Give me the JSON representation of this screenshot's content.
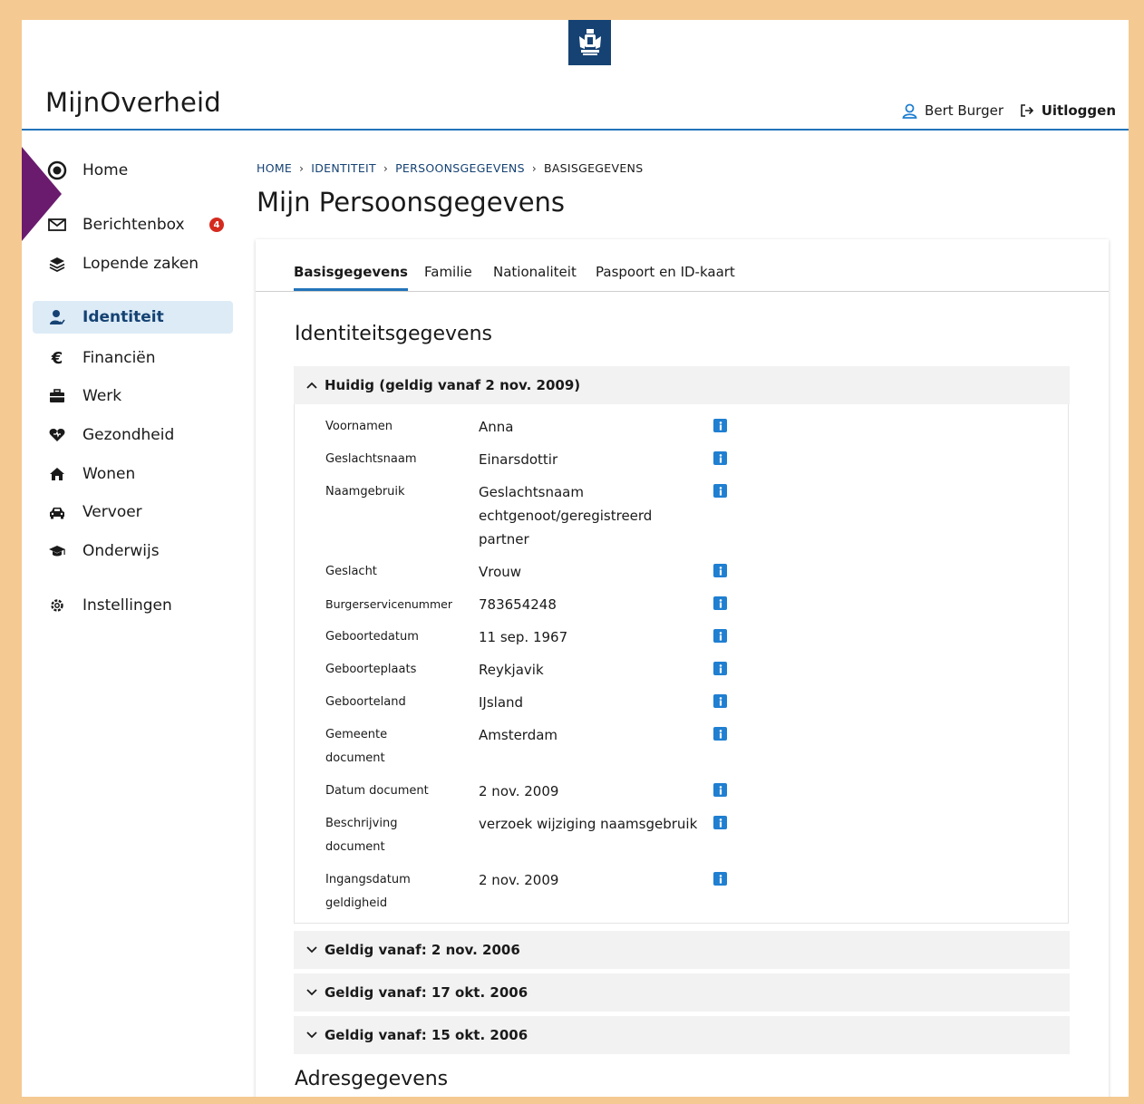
{
  "app": {
    "brand": "MijnOverheid"
  },
  "header": {
    "user_name": "Bert Burger",
    "logout_label": "Uitloggen"
  },
  "sidebar": {
    "items": [
      {
        "label": "Home",
        "icon": "home-circle-icon"
      },
      {
        "label": "Berichtenbox",
        "icon": "envelope-icon",
        "badge": "4"
      },
      {
        "label": "Lopende zaken",
        "icon": "layers-icon"
      },
      {
        "label": "Identiteit",
        "icon": "person-icon",
        "active": true
      },
      {
        "label": "Financiën",
        "icon": "euro-icon"
      },
      {
        "label": "Werk",
        "icon": "briefcase-icon"
      },
      {
        "label": "Gezondheid",
        "icon": "heart-icon"
      },
      {
        "label": "Wonen",
        "icon": "house-icon"
      },
      {
        "label": "Vervoer",
        "icon": "car-icon"
      },
      {
        "label": "Onderwijs",
        "icon": "graduation-cap-icon"
      },
      {
        "label": "Instellingen",
        "icon": "gear-icon"
      }
    ]
  },
  "breadcrumb": [
    "HOME",
    "IDENTITEIT",
    "PERSOONSGEGEVENS",
    "BASISGEGEVENS"
  ],
  "page": {
    "title": "Mijn Persoonsgegevens"
  },
  "tabs": [
    "Basisgegevens",
    "Familie",
    "Nationaliteit",
    "Paspoort en ID-kaart"
  ],
  "sections": {
    "identity_title": "Identiteitsgegevens",
    "address_title": "Adresgegevens"
  },
  "accordion": {
    "open_header": "Huidig (geldig vanaf 2 nov. 2009)",
    "rows": [
      {
        "label": "Voornamen",
        "value": "Anna"
      },
      {
        "label": "Geslachtsnaam",
        "value": "Einarsdottir"
      },
      {
        "label": "Naamgebruik",
        "value": "Geslachtsnaam echtgenoot/geregistreerd partner"
      },
      {
        "label": "Geslacht",
        "value": "Vrouw"
      },
      {
        "label": "Burgerservicenummer",
        "value": "783654248"
      },
      {
        "label": "Geboortedatum",
        "value": "11 sep. 1967"
      },
      {
        "label": "Geboorteplaats",
        "value": "Reykjavik"
      },
      {
        "label": "Geboorteland",
        "value": "IJsland"
      },
      {
        "label": "Gemeente document",
        "value": "Amsterdam"
      },
      {
        "label": "Datum document",
        "value": "2 nov. 2009"
      },
      {
        "label": "Beschrijving document",
        "value": "verzoek wijziging naamsgebruik"
      },
      {
        "label": "Ingangsdatum geldigheid",
        "value": "2 nov. 2009"
      }
    ],
    "collapsed": [
      "Geldig vanaf: 2 nov. 2006",
      "Geldig vanaf: 17 okt. 2006",
      "Geldig vanaf: 15 okt. 2006"
    ]
  },
  "colors": {
    "brand_blue": "#154273",
    "accent_blue": "#2274ba",
    "info_blue": "#1f7fd1",
    "badge_red": "#d52b1e",
    "pointer_purple": "#6a1b6e",
    "frame_orange": "#f5c992"
  }
}
